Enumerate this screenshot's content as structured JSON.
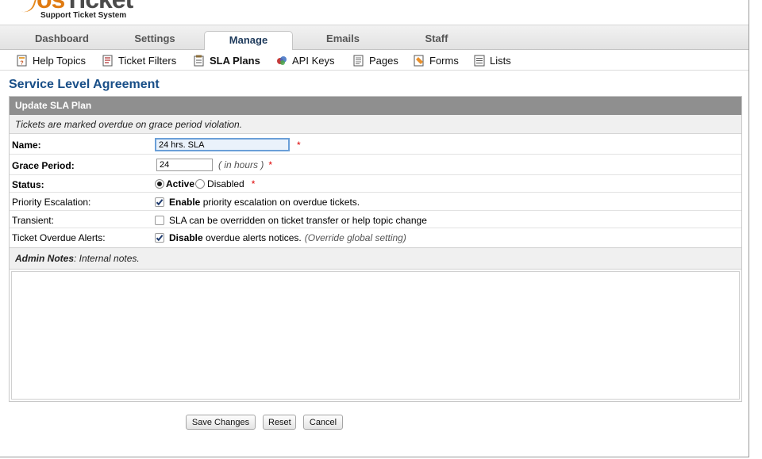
{
  "app": {
    "logo_text_main": "osTicket",
    "logo_text_sub": "Support Ticket System"
  },
  "main_nav": {
    "tabs": [
      {
        "label": "Dashboard",
        "active": false
      },
      {
        "label": "Settings",
        "active": false
      },
      {
        "label": "Manage",
        "active": true
      },
      {
        "label": "Emails",
        "active": false
      },
      {
        "label": "Staff",
        "active": false
      }
    ]
  },
  "sub_nav": {
    "items": [
      {
        "label": "Help Topics",
        "icon": "help-topics-icon",
        "active": false
      },
      {
        "label": "Ticket Filters",
        "icon": "ticket-filters-icon",
        "active": false
      },
      {
        "label": "SLA Plans",
        "icon": "sla-plans-icon",
        "active": true
      },
      {
        "label": "API Keys",
        "icon": "api-keys-icon",
        "active": false
      },
      {
        "label": "Pages",
        "icon": "pages-icon",
        "active": false
      },
      {
        "label": "Forms",
        "icon": "forms-icon",
        "active": false
      },
      {
        "label": "Lists",
        "icon": "lists-icon",
        "active": false
      }
    ]
  },
  "page": {
    "title": "Service Level Agreement"
  },
  "form": {
    "header": "Update SLA Plan",
    "subheader": "Tickets are marked overdue on grace period violation.",
    "required_mark": "*",
    "name": {
      "label": "Name:",
      "value": "24 hrs. SLA"
    },
    "grace_period": {
      "label": "Grace Period:",
      "value": "24",
      "hint": "( in hours )"
    },
    "status": {
      "label": "Status:",
      "option_active": "Active",
      "option_disabled": "Disabled",
      "selected": "Active"
    },
    "priority_escalation": {
      "label": "Priority Escalation:",
      "checked": true,
      "text_bold": "Enable",
      "text": "priority escalation on overdue tickets."
    },
    "transient": {
      "label": "Transient:",
      "checked": false,
      "text": "SLA can be overridden on ticket transfer or help topic change"
    },
    "overdue_alerts": {
      "label": "Ticket Overdue Alerts:",
      "checked": true,
      "text_bold": "Disable",
      "text": "overdue alerts notices.",
      "hint": "(Override global setting)"
    },
    "admin_notes": {
      "label": "Admin Notes",
      "hint": ": Internal notes.",
      "value": ""
    }
  },
  "buttons": {
    "save": "Save Changes",
    "reset": "Reset",
    "cancel": "Cancel"
  },
  "colors": {
    "title_blue": "#184e87",
    "logo_orange": "#e07b12",
    "header_gray": "#8f8f8f",
    "required_red": "#d00000"
  }
}
